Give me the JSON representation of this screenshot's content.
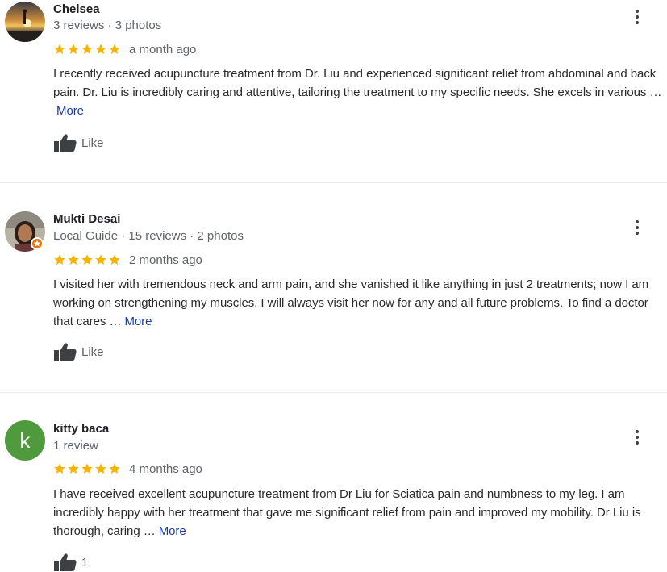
{
  "reviews": [
    {
      "author": "Chelsea",
      "meta": "3 reviews · 3 photos",
      "rating": 5,
      "date": "a month ago",
      "text": "I recently received acupuncture treatment from Dr. Liu and experienced significant relief from abdominal and back pain. Dr. Liu is incredibly caring and attentive, tailoring the treatment to my specific needs. She excels in various …",
      "more_label": "More",
      "like_label": "Like",
      "avatar_icon": "sunset-photo-avatar"
    },
    {
      "author": "Mukti Desai",
      "meta": "Local Guide · 15 reviews · 2 photos",
      "rating": 5,
      "date": "2 months ago",
      "text": "I visited her with tremendous neck and arm pain, and she vanished it like anything in just 2 treatments; now I am working on strengthening my muscles. I will always visit her now for any and all future problems. To find a doctor that cares …",
      "more_label": "More",
      "like_label": "Like",
      "avatar_icon": "portrait-photo-avatar",
      "badge_icon": "local-guide-star-icon"
    },
    {
      "author": "kitty baca",
      "meta": "1 review",
      "rating": 5,
      "date": "4 months ago",
      "text": "I have received excellent acupuncture treatment from Dr Liu for Sciatica pain and numbness to my leg.  I am incredibly happy with her treatment that gave me significant relief from pain and improved my mobility. Dr Liu is thorough, caring …",
      "more_label": "More",
      "like_label": "1",
      "avatar_letter": "k",
      "avatar_color": "#4f9a3d"
    }
  ],
  "colors": {
    "star": "#f4b400",
    "link": "#1a3ea0",
    "secondary_text": "#5f6368",
    "icon": "#3c4043"
  }
}
